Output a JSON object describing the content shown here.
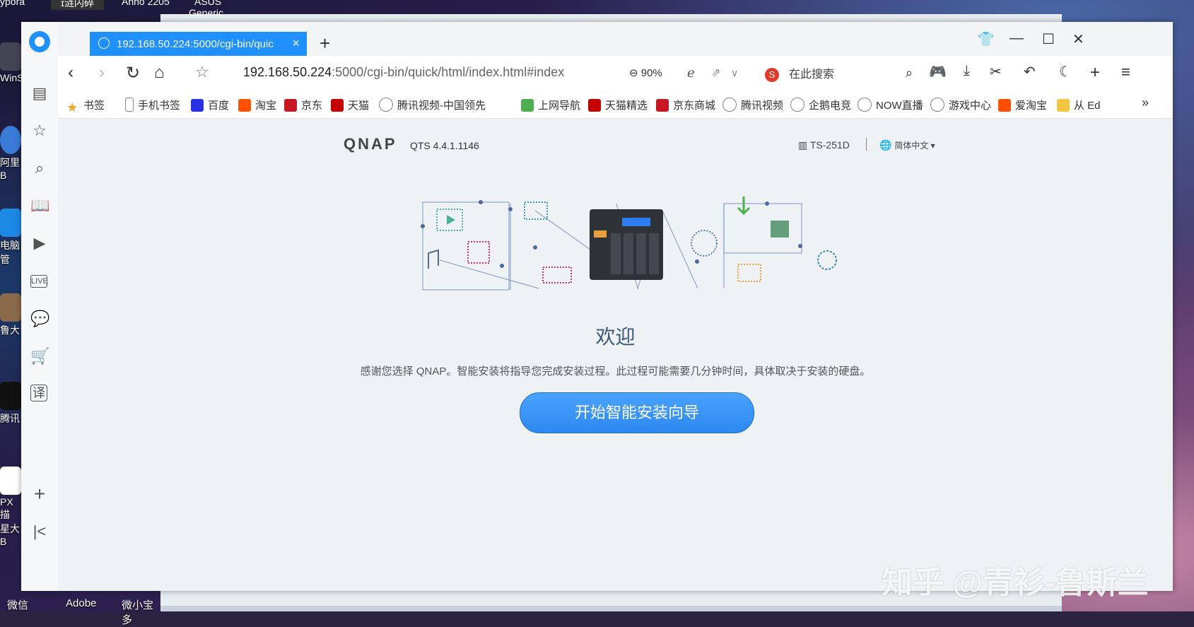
{
  "desktop": {
    "top_items": [
      "ypora",
      "ɪ涟闪碎",
      "Anno 2205",
      "ASUS",
      "Generic"
    ],
    "left_items": [
      "WinS",
      "阿里B",
      "电脑管",
      "鲁大",
      "腾讯",
      "PX描",
      "星大B",
      "微信"
    ],
    "bottom_items": [
      "微信",
      "Adobe",
      "微小宝多"
    ]
  },
  "tab": {
    "title": "192.168.50.224:5000/cgi-bin/quic",
    "close": "×"
  },
  "navbar": {
    "url_host": "192.168.50.224",
    "url_rest": ":5000/cgi-bin/quick/html/index.html#index",
    "zoom": "90%",
    "search_placeholder": "在此搜索"
  },
  "bookmarks": [
    {
      "label": "书签",
      "icon": "star-icon",
      "color": "#f5a623"
    },
    {
      "label": "手机书签",
      "icon": "phone-icon",
      "color": "#888"
    },
    {
      "label": "百度",
      "icon": "baidu-icon",
      "color": "#2932e1"
    },
    {
      "label": "淘宝",
      "icon": "taobao-icon",
      "color": "#ff5000"
    },
    {
      "label": "京东",
      "icon": "jd-icon",
      "color": "#c91623"
    },
    {
      "label": "天猫",
      "icon": "tmall-icon",
      "color": "#c40000"
    },
    {
      "label": "腾讯视频-中国领先",
      "icon": "globe-icon",
      "color": "#888"
    },
    {
      "label": "上网导航",
      "icon": "hao-icon",
      "color": "#4caf50"
    },
    {
      "label": "天猫精选",
      "icon": "tmall-icon",
      "color": "#c40000"
    },
    {
      "label": "京东商城",
      "icon": "jd-icon",
      "color": "#c91623"
    },
    {
      "label": "腾讯视频",
      "icon": "globe-icon",
      "color": "#888"
    },
    {
      "label": "企鹅电竞",
      "icon": "globe-icon",
      "color": "#888"
    },
    {
      "label": "NOW直播",
      "icon": "globe-icon",
      "color": "#888"
    },
    {
      "label": "游戏中心",
      "icon": "globe-icon",
      "color": "#888"
    },
    {
      "label": "爱淘宝",
      "icon": "taobao-icon",
      "color": "#ff5000"
    },
    {
      "label": "从 Ed",
      "icon": "folder-icon",
      "color": "#f5c542"
    }
  ],
  "bookmarks_more": "»",
  "page": {
    "logo": "QNAP",
    "version": "QTS 4.4.1.1146",
    "model": "TS-251D",
    "language": "简体中文",
    "welcome": "欢迎",
    "description": "感谢您选择 QNAP。智能安装将指导您完成安装过程。此过程可能需要几分钟时间，具体取决于安装的硬盘。",
    "start_button": "开始智能安装向导"
  },
  "watermark": "知乎 @青衫-鲁斯兰",
  "colors": {
    "accent": "#1e90ff",
    "page_bg": "#eef2f5",
    "heading": "#3b5a78"
  }
}
